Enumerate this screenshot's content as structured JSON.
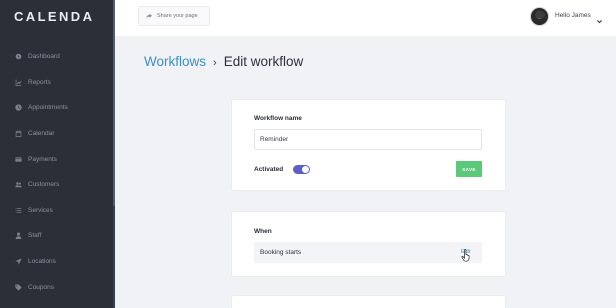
{
  "app": {
    "logo": "CALENDA"
  },
  "sidebar": {
    "items": [
      {
        "label": "Dashboard",
        "icon": "dashboard-icon"
      },
      {
        "label": "Reports",
        "icon": "chart-icon"
      },
      {
        "label": "Appointments",
        "icon": "clock-icon"
      },
      {
        "label": "Calendar",
        "icon": "calendar-icon"
      },
      {
        "label": "Payments",
        "icon": "card-icon"
      },
      {
        "label": "Customers",
        "icon": "users-icon"
      },
      {
        "label": "Services",
        "icon": "list-icon"
      },
      {
        "label": "Staff",
        "icon": "user-icon"
      },
      {
        "label": "Locations",
        "icon": "location-icon"
      },
      {
        "label": "Coupons",
        "icon": "tag-icon"
      }
    ]
  },
  "topbar": {
    "share_label": "Share your page",
    "greeting": "Hello James"
  },
  "breadcrumb": {
    "parent": "Workflows",
    "separator": "›",
    "current": "Edit workflow"
  },
  "workflow": {
    "name_label": "Workflow name",
    "name_value": "Reminder",
    "activated_label": "Activated",
    "activated": true,
    "save_label": "SAVE"
  },
  "when": {
    "label": "When",
    "trigger": "Booking starts",
    "edit_label": "Edit"
  },
  "colors": {
    "sidebar_bg": "#2b2f38",
    "accent": "#3b8fc7",
    "toggle_on": "#5b5fc7",
    "save_green": "#5bc87a"
  }
}
